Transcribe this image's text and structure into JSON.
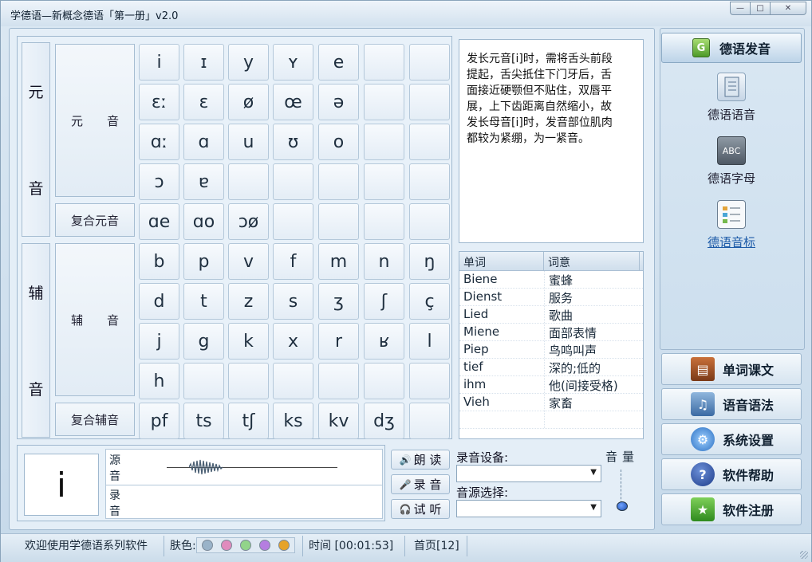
{
  "window": {
    "title": "学德语—新概念德语「第一册」v2.0",
    "min": "—",
    "max": "□",
    "close": "✕"
  },
  "vowel_section": {
    "label_chars": [
      "元",
      "音"
    ],
    "cat_main": "元　　音",
    "cat_compound": "复合元音",
    "rows": [
      [
        "i",
        "ɪ",
        "y",
        "ʏ",
        "e",
        "",
        ""
      ],
      [
        "ɛː",
        "ɛ",
        "ø",
        "œ",
        "ə",
        "",
        ""
      ],
      [
        "ɑː",
        "ɑ",
        "u",
        "ʊ",
        "o",
        "",
        ""
      ],
      [
        "ɔ",
        "ɐ",
        "",
        "",
        "",
        "",
        ""
      ],
      [
        "ɑe",
        "ɑo",
        "ɔø",
        "",
        "",
        "",
        ""
      ]
    ]
  },
  "consonant_section": {
    "label_chars": [
      "辅",
      "音"
    ],
    "cat_main": "辅　　音",
    "cat_compound": "复合辅音",
    "rows": [
      [
        "b",
        "p",
        "v",
        "f",
        "m",
        "n",
        "ŋ"
      ],
      [
        "d",
        "t",
        "z",
        "s",
        "ʒ",
        "ʃ",
        "ç"
      ],
      [
        "j",
        "g",
        "k",
        "x",
        "r",
        "ʁ",
        "l"
      ],
      [
        "h",
        "",
        "",
        "",
        "",
        "",
        ""
      ],
      [
        "pf",
        "ts",
        "tʃ",
        "ks",
        "kv",
        "dʒ",
        ""
      ]
    ]
  },
  "description": {
    "lines": [
      "发长元音[i]时，需将舌头前段",
      "提起，舌尖抵住下门牙后，舌",
      "面接近硬颚但不贴住，双唇平",
      "展，上下齿距离自然缩小，故",
      "发长母音[i]时，发音部位肌肉",
      "都较为紧绷，为一紧音。"
    ]
  },
  "word_table": {
    "headers": [
      "单词",
      "词意"
    ],
    "rows": [
      [
        "Biene",
        "蜜蜂"
      ],
      [
        "Dienst",
        "服务"
      ],
      [
        "Lied",
        "歌曲"
      ],
      [
        "Miene",
        "面部表情"
      ],
      [
        "Piep",
        "鸟鸣叫声"
      ],
      [
        "tief",
        "深的;低的"
      ],
      [
        "ihm",
        "他(间接受格)"
      ],
      [
        "Vieh",
        "家畜"
      ],
      [
        "",
        ""
      ]
    ]
  },
  "player": {
    "current_char": "i",
    "source_label": [
      "源",
      "音"
    ],
    "record_label": [
      "录",
      "音"
    ],
    "btn_read": "朗 读",
    "btn_record": "录 音",
    "btn_listen": "试 听",
    "record_device_label": "录音设备:",
    "source_select_label": "音源选择:",
    "record_device_value": "",
    "source_select_value": "",
    "volume_label": "音量",
    "volume_level": 0.05
  },
  "sidebar": {
    "header": "德语发音",
    "items": [
      {
        "label": "德语语音",
        "icon": "notebook-icon"
      },
      {
        "label": "德语字母",
        "icon": "abc-board-icon"
      },
      {
        "label": "德语音标",
        "icon": "phonetic-chart-icon"
      }
    ],
    "abc_text": "ABC",
    "nav": [
      {
        "label": "单词课文",
        "icon": "books-icon"
      },
      {
        "label": "语音语法",
        "icon": "media-icon"
      },
      {
        "label": "系统设置",
        "icon": "gears-icon"
      },
      {
        "label": "软件帮助",
        "icon": "help-icon"
      },
      {
        "label": "软件注册",
        "icon": "register-icon"
      }
    ]
  },
  "status": {
    "welcome": "欢迎使用学德语系列软件",
    "skin_label": "肤色:",
    "skin_colors": [
      "#9ab3c9",
      "#e08bbd",
      "#92d48a",
      "#b57ee0",
      "#e6a32a"
    ],
    "time": "时间 [00:01:53]",
    "page": "首页[12]"
  }
}
